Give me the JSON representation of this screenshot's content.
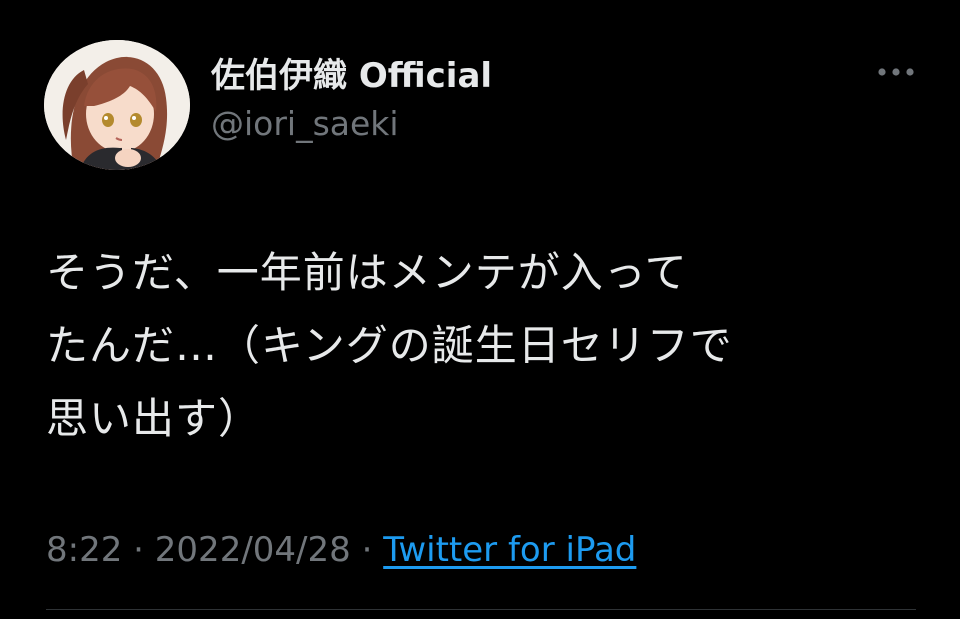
{
  "tweet": {
    "author": {
      "display_name": "佐伯伊織 Official",
      "handle": "@iori_saeki",
      "avatar_icon": "avatar-illustration"
    },
    "more_icon": "more-horizontal-icon",
    "text": "そうだ、一年前はメンテが入って\nたんだ…（キングの誕生日セリフで\n思い出す）",
    "time": "8:22",
    "separator": "·",
    "date": "2022/04/28",
    "source": "Twitter for iPad"
  },
  "colors": {
    "background": "#000000",
    "primary_text": "#e7e9ea",
    "secondary_text": "#71767b",
    "link": "#1d9bf0",
    "divider": "#2f3336"
  }
}
